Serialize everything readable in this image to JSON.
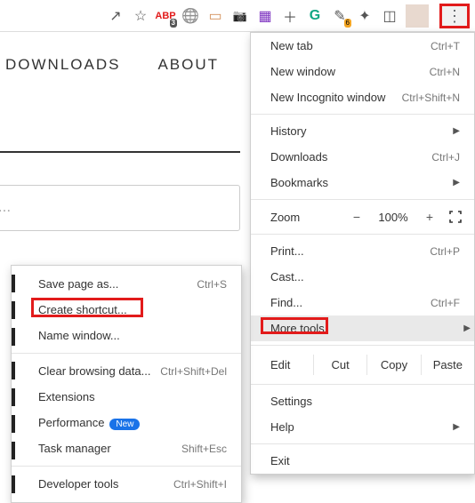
{
  "toolbar": {
    "share": "↗",
    "star": "☆",
    "abp": "ABP",
    "abp_badge": "3",
    "globe": "🌐",
    "note": "▭",
    "camera": "📷",
    "grid": "▦",
    "plus": "＋",
    "grammarly": "G",
    "pen": "✎",
    "pen_badge": "6",
    "puzzle": "✦",
    "square": "◫",
    "avatar": "",
    "kebab": "⋮"
  },
  "page": {
    "nav": {
      "downloads": "DOWNLOADS",
      "about": "ABOUT"
    },
    "search_placeholder": "te ..."
  },
  "menu": {
    "new_tab": {
      "label": "New tab",
      "shortcut": "Ctrl+T"
    },
    "new_window": {
      "label": "New window",
      "shortcut": "Ctrl+N"
    },
    "new_incognito": {
      "label": "New Incognito window",
      "shortcut": "Ctrl+Shift+N"
    },
    "history": {
      "label": "History"
    },
    "downloads": {
      "label": "Downloads",
      "shortcut": "Ctrl+J"
    },
    "bookmarks": {
      "label": "Bookmarks"
    },
    "zoom": {
      "label": "Zoom",
      "minus": "−",
      "value": "100%",
      "plus": "+"
    },
    "print": {
      "label": "Print...",
      "shortcut": "Ctrl+P"
    },
    "cast": {
      "label": "Cast..."
    },
    "find": {
      "label": "Find...",
      "shortcut": "Ctrl+F"
    },
    "more_tools": {
      "label": "More tools"
    },
    "edit": {
      "label": "Edit",
      "cut": "Cut",
      "copy": "Copy",
      "paste": "Paste"
    },
    "settings": {
      "label": "Settings"
    },
    "help": {
      "label": "Help"
    },
    "exit": {
      "label": "Exit"
    }
  },
  "submenu": {
    "save_page": {
      "label": "Save page as...",
      "shortcut": "Ctrl+S"
    },
    "create_shortcut": {
      "label": "Create shortcut..."
    },
    "name_window": {
      "label": "Name window..."
    },
    "clear_data": {
      "label": "Clear browsing data...",
      "shortcut": "Ctrl+Shift+Del"
    },
    "extensions": {
      "label": "Extensions"
    },
    "performance": {
      "label": "Performance",
      "badge": "New"
    },
    "task_manager": {
      "label": "Task manager",
      "shortcut": "Shift+Esc"
    },
    "dev_tools": {
      "label": "Developer tools",
      "shortcut": "Ctrl+Shift+I"
    }
  },
  "colors": {
    "highlight_border": "#e21b1b",
    "badge_blue": "#1a73e8"
  }
}
